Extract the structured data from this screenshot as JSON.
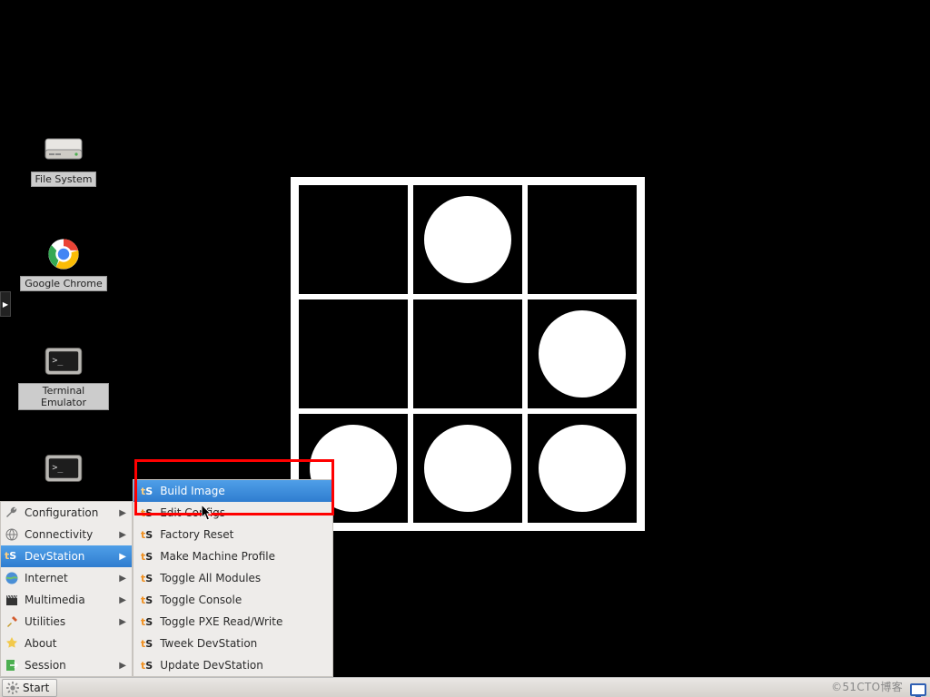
{
  "desktop_icons": {
    "filesystem": {
      "label": "File System"
    },
    "chrome": {
      "label": "Google Chrome"
    },
    "terminal": {
      "label": "Terminal Emulator"
    }
  },
  "panel_tab_glyph": "▶",
  "menu": {
    "items": [
      {
        "label": "Configuration"
      },
      {
        "label": "Connectivity"
      },
      {
        "label": "DevStation"
      },
      {
        "label": "Internet"
      },
      {
        "label": "Multimedia"
      },
      {
        "label": "Utilities"
      },
      {
        "label": "About"
      },
      {
        "label": "Session"
      }
    ]
  },
  "submenu": {
    "items": [
      {
        "label": "Build Image"
      },
      {
        "label": "Edit Configs"
      },
      {
        "label": "Factory Reset"
      },
      {
        "label": "Make Machine Profile"
      },
      {
        "label": "Toggle All Modules"
      },
      {
        "label": "Toggle Console"
      },
      {
        "label": "Toggle PXE Read/Write"
      },
      {
        "label": "Tweek DevStation"
      },
      {
        "label": "Update DevStation"
      }
    ]
  },
  "submenu_icon": {
    "t": "t",
    "s": "S"
  },
  "taskbar": {
    "start_label": "Start"
  },
  "watermark": "©51CTO博客",
  "logo_grid": [
    [
      0,
      1,
      0
    ],
    [
      0,
      0,
      1
    ],
    [
      1,
      1,
      1
    ]
  ]
}
